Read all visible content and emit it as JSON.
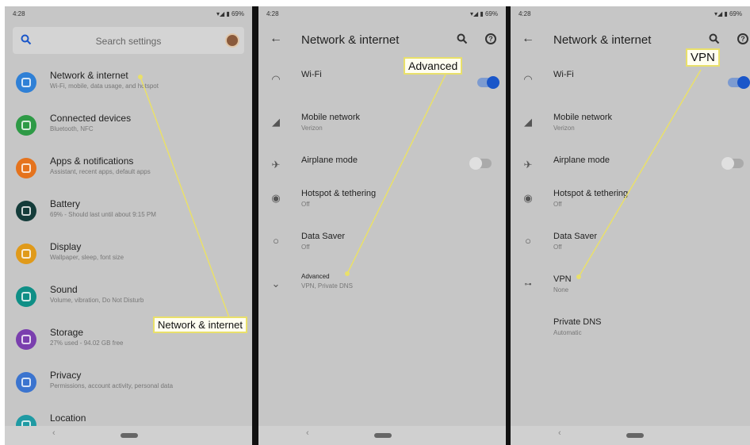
{
  "panel1": {
    "status": {
      "time": "4:28",
      "icons": "▾◢ ▮ 69%"
    },
    "search": {
      "label": "Search settings"
    },
    "items": [
      {
        "title": "Network & internet",
        "subtitle": "Wi-Fi, mobile, data usage, and hotspot",
        "color": "#2f80d6"
      },
      {
        "title": "Connected devices",
        "subtitle": "Bluetooth, NFC",
        "color": "#2e9a46"
      },
      {
        "title": "Apps & notifications",
        "subtitle": "Assistant, recent apps, default apps",
        "color": "#e5731d"
      },
      {
        "title": "Battery",
        "subtitle": "69% - Should last until about 9:15 PM",
        "color": "#143c3a"
      },
      {
        "title": "Display",
        "subtitle": "Wallpaper, sleep, font size",
        "color": "#e09a1a"
      },
      {
        "title": "Sound",
        "subtitle": "Volume, vibration, Do Not Disturb",
        "color": "#0f8f86"
      },
      {
        "title": "Storage",
        "subtitle": "27% used - 94.02 GB free",
        "color": "#7a3fae"
      },
      {
        "title": "Privacy",
        "subtitle": "Permissions, account activity, personal data",
        "color": "#3b74cf"
      },
      {
        "title": "Location",
        "subtitle": "",
        "color": "#1f9aa3"
      }
    ],
    "callout": "Network & internet"
  },
  "panel2": {
    "status": {
      "time": "4:28",
      "icons": "▾◢ ▮ 69%"
    },
    "header": {
      "title": "Network & internet"
    },
    "rows": [
      {
        "title": "Wi-Fi",
        "subtitle": "",
        "icon": "wifi-icon"
      },
      {
        "title": "Mobile network",
        "subtitle": "Verizon",
        "icon": "signal-icon"
      },
      {
        "title": "Airplane mode",
        "subtitle": "",
        "icon": "airplane-icon"
      },
      {
        "title": "Hotspot & tethering",
        "subtitle": "Off",
        "icon": "hotspot-icon"
      },
      {
        "title": "Data Saver",
        "subtitle": "Off",
        "icon": "data-saver-icon"
      },
      {
        "title": "Advanced",
        "subtitle": "VPN, Private DNS",
        "icon": "chevron-down-icon"
      }
    ],
    "toggles": {
      "wifi": "on",
      "airplane": "off"
    },
    "callout": "Advanced"
  },
  "panel3": {
    "status": {
      "time": "4:28",
      "icons": "▾◢ ▮ 69%"
    },
    "header": {
      "title": "Network & internet"
    },
    "rows": [
      {
        "title": "Wi-Fi",
        "subtitle": "",
        "icon": "wifi-icon"
      },
      {
        "title": "Mobile network",
        "subtitle": "Verizon",
        "icon": "signal-icon"
      },
      {
        "title": "Airplane mode",
        "subtitle": "",
        "icon": "airplane-icon"
      },
      {
        "title": "Hotspot & tethering",
        "subtitle": "Off",
        "icon": "hotspot-icon"
      },
      {
        "title": "Data Saver",
        "subtitle": "Off",
        "icon": "data-saver-icon"
      },
      {
        "title": "VPN",
        "subtitle": "None",
        "icon": "vpn-key-icon"
      },
      {
        "title": "Private DNS",
        "subtitle": "Automatic",
        "icon": ""
      }
    ],
    "toggles": {
      "wifi": "on",
      "airplane": "off"
    },
    "callout": "VPN"
  },
  "colors": {
    "highlight": "#e9e06a",
    "toggle_on": "#1a56c9",
    "panel_bg": "#c6c6c6"
  }
}
